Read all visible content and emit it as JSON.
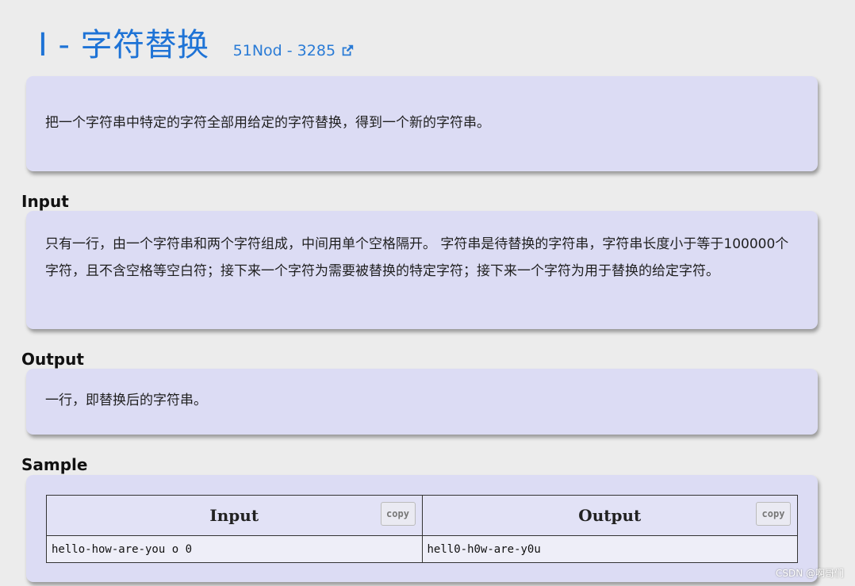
{
  "header": {
    "title": "I - 字符替换",
    "origin": "51Nod - 3285"
  },
  "description": {
    "text": "把一个字符串中特定的字符全部用给定的字符替换，得到一个新的字符串。"
  },
  "input_section": {
    "label": "Input",
    "text": "只有一行，由一个字符串和两个字符组成，中间用单个空格隔开。 字符串是待替换的字符串，字符串长度小于等于100000个字符，且不含空格等空白符；接下来一个字符为需要被替换的特定字符；接下来一个字符为用于替换的给定字符。"
  },
  "output_section": {
    "label": "Output",
    "text": "一行，即替换后的字符串。"
  },
  "sample_section": {
    "label": "Sample",
    "columns": [
      "Input",
      "Output"
    ],
    "copy_label": "copy",
    "input_value": "hello-how-are-you o 0",
    "output_value": "hell0-h0w-are-y0u"
  },
  "watermark": "CSDN @啊哥们",
  "colors": {
    "accent": "#1e73d6",
    "card_bg": "#dcdcf4",
    "page_bg": "#ececec"
  }
}
